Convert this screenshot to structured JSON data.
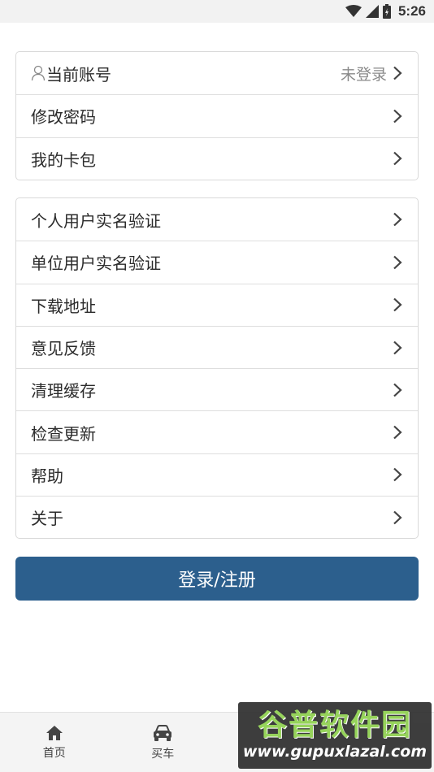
{
  "status_bar": {
    "time": "5:26"
  },
  "account_group": {
    "items": [
      {
        "label": "当前账号",
        "value": "未登录"
      },
      {
        "label": "修改密码"
      },
      {
        "label": "我的卡包"
      }
    ]
  },
  "settings_group": {
    "items": [
      {
        "label": "个人用户实名验证"
      },
      {
        "label": "单位用户实名验证"
      },
      {
        "label": "下载地址"
      },
      {
        "label": "意见反馈"
      },
      {
        "label": "清理缓存"
      },
      {
        "label": "检查更新"
      },
      {
        "label": "帮助"
      },
      {
        "label": "关于"
      }
    ]
  },
  "login_button": {
    "label": "登录/注册"
  },
  "tab_bar": {
    "tabs": [
      {
        "label": "首页",
        "icon": "home-icon"
      },
      {
        "label": "买车",
        "icon": "car-icon"
      }
    ]
  },
  "watermark": {
    "title": "谷普软件园",
    "url": "www.gupuxlazal.com"
  }
}
